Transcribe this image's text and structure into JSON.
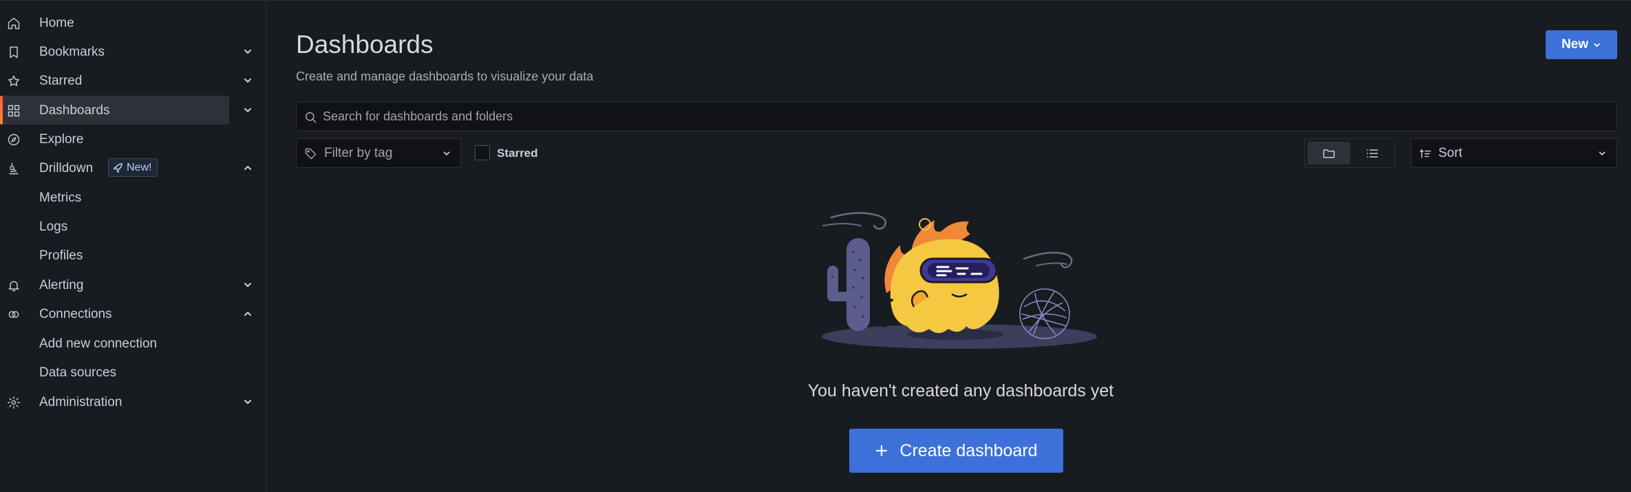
{
  "sidebar": {
    "items": [
      {
        "label": "Home",
        "icon": "home-icon",
        "has_chevron": false,
        "expanded": false
      },
      {
        "label": "Bookmarks",
        "icon": "bookmark-icon",
        "has_chevron": true,
        "expanded": false
      },
      {
        "label": "Starred",
        "icon": "star-icon",
        "has_chevron": true,
        "expanded": false
      },
      {
        "label": "Dashboards",
        "icon": "apps-icon",
        "has_chevron": true,
        "expanded": false,
        "active": true
      },
      {
        "label": "Explore",
        "icon": "compass-icon",
        "has_chevron": false,
        "expanded": false
      },
      {
        "label": "Drilldown",
        "icon": "drilldown-icon",
        "has_chevron": true,
        "expanded": true,
        "badge": "New!"
      },
      {
        "label": "Metrics",
        "sub": true
      },
      {
        "label": "Logs",
        "sub": true
      },
      {
        "label": "Profiles",
        "sub": true
      },
      {
        "label": "Alerting",
        "icon": "bell-icon",
        "has_chevron": true,
        "expanded": false
      },
      {
        "label": "Connections",
        "icon": "connections-icon",
        "has_chevron": true,
        "expanded": true
      },
      {
        "label": "Add new connection",
        "sub": true
      },
      {
        "label": "Data sources",
        "sub": true
      },
      {
        "label": "Administration",
        "icon": "cog-icon",
        "has_chevron": true,
        "expanded": false
      }
    ]
  },
  "header": {
    "title": "Dashboards",
    "subtitle": "Create and manage dashboards to visualize your data",
    "new_button": "New"
  },
  "search": {
    "placeholder": "Search for dashboards and folders",
    "value": ""
  },
  "filters": {
    "tag_placeholder": "Filter by tag",
    "starred_label": "Starred",
    "starred_checked": false,
    "view_mode": "folder",
    "sort_label": "Sort"
  },
  "empty_state": {
    "message": "You haven't created any dashboards yet",
    "create_button": "Create dashboard"
  },
  "colors": {
    "accent": "#3d71d9",
    "active_bar": "#f55f3e",
    "background": "#181b1f"
  }
}
